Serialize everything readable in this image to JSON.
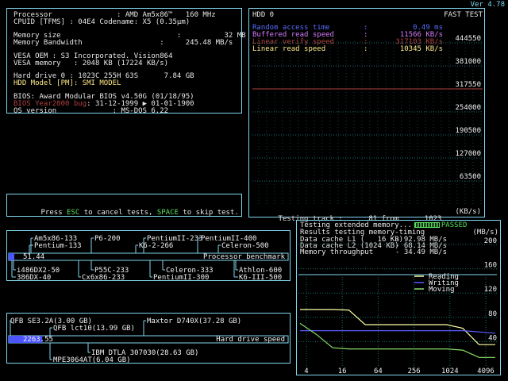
{
  "version": "Ver 4.78",
  "sysinfo": {
    "lines": [
      "Processor               : AMD Am5x86™   160 MHz",
      "CPUID [TFMS] : 04E4 Codename: X5 (0.35µm)",
      "Memory size                           :          32 MB",
      "Memory Bandwidth                  :     245.48 MB/s",
      "VESA OEM : S3 Incorporated. Vision864",
      "VESA memory   : 2048 KB (17224 KB/s)",
      "Hard drive 0 : 1023C 255H 63S      7.84 GB",
      "HDD Model [PM]: SMI MODEL",
      "BIOS: Award Modular BIOS v4.50G (01/18/95)",
      "RTC Bug: 31-12-1999 ▶ 01-01-1900",
      "OS version             : MS-DOS 6.22"
    ],
    "rtc_prefix": "BIOS ",
    "rtc_red": "Year2000 bug",
    "rtc_rest": ": 31-12-1999 ▶ 01-01-1900"
  },
  "prompt": {
    "pre": "Press ",
    "esc": "ESC",
    "mid": " to cancel tests, ",
    "space": "SPACE",
    "post": " to skip test."
  },
  "hdd": {
    "title": "HDD 0",
    "mode": "FAST TEST",
    "stats": [
      {
        "label": "Random access time",
        "sep": ":",
        "value": "0.49 ms",
        "color": "#5a6cff"
      },
      {
        "label": "Buffered read speed",
        "sep": ":",
        "value": "11566 KB/s",
        "color": "#d77cff"
      },
      {
        "label": "Linear verify speed",
        "sep": ":",
        "value": "317103 KB/s",
        "color": "#b04040"
      },
      {
        "label": "Linear read speed",
        "sep": ":",
        "value": "10345 KB/s",
        "color": "#ffe98a"
      }
    ],
    "y_ticks": [
      "444550",
      "381000",
      "317550",
      "254000",
      "190500",
      "127000",
      "63500"
    ],
    "track_label": "Testing track :",
    "track_current": "81",
    "track_from": "from",
    "track_total": "1023",
    "unit": "(KB/s)"
  },
  "cpu_bench": {
    "top_labels": [
      "Am5x86-133",
      "P6-200",
      "PentiumII-233",
      "PentiumII-400",
      "Pentium-133",
      "K6-2-266",
      "Celeron-500"
    ],
    "bottom_labels": [
      "i486DX2-50",
      "P55C-233",
      "Celeron-333",
      "Athlon-600",
      "386DX-40",
      "Cx6x86-233",
      "PentiumII-300",
      "K6-III-500"
    ],
    "value": "51.44",
    "bar_title": "Processor benchmark",
    "fill": 0.02
  },
  "hdd_bench": {
    "top_labels": [
      "QFB SE3.2A(3.00 GB)",
      "Maxtor D740X(37.28 GB)",
      "QFB lct10(13.99 GB)"
    ],
    "bottom_labels": [
      "IBM DTLA 307030(28.63 GB)",
      "MPE3064AT(6.04 GB)"
    ],
    "value": "2263.55",
    "bar_title": "Hard drive speed",
    "fill": 0.12
  },
  "memory": {
    "status_label": "Testing extended memory...",
    "status_value": "PASSED",
    "results_title": "Results testing memory-timing",
    "unit": "(MB/s)",
    "rows": [
      {
        "label": "Data cache L1 (   16 KB)",
        "value": "92.98 MB/s"
      },
      {
        "label": "Data cache L2 (1024 KB)",
        "value": "68.14 MB/s"
      },
      {
        "label": "Memory throughput",
        "value": "34.49 MB/s"
      }
    ],
    "legend": [
      {
        "name": "Reading",
        "color": "#ffffa0"
      },
      {
        "name": "Writing",
        "color": "#5a5aff"
      },
      {
        "name": "Moving",
        "color": "#8be06a"
      }
    ]
  },
  "colors": {
    "panel_border": "#7fd6ee",
    "accent_green": "#58e05a",
    "bar_blue": "#4c55ff"
  },
  "chart_data": [
    {
      "type": "line",
      "title": "HDD 0",
      "ylim": [
        0,
        444550
      ],
      "xlabel": "",
      "ylabel": "(KB/s)",
      "series": [
        {
          "name": "Linear verify speed",
          "x": [
            0,
            81
          ],
          "values": [
            317550,
            317550
          ]
        }
      ]
    },
    {
      "type": "line",
      "title": "Results testing memory-timing",
      "ylabel": "(MB/s)",
      "ylim": [
        0,
        200
      ],
      "y_ticks": [
        200,
        160,
        120,
        80,
        40
      ],
      "x_ticks": [
        "4",
        "16",
        "64",
        "256",
        "1024",
        "4096"
      ],
      "series": [
        {
          "name": "Reading",
          "values": [
            93,
            93,
            93,
            92,
            68,
            68,
            68,
            68,
            68,
            68,
            62,
            35,
            35
          ]
        },
        {
          "name": "Writing",
          "values": [
            58,
            58,
            58,
            58,
            58,
            58,
            58,
            58,
            58,
            58,
            58,
            56,
            54
          ]
        },
        {
          "name": "Moving",
          "values": [
            70,
            52,
            30,
            28,
            28,
            28,
            28,
            28,
            28,
            28,
            26,
            14,
            14
          ]
        }
      ]
    }
  ]
}
